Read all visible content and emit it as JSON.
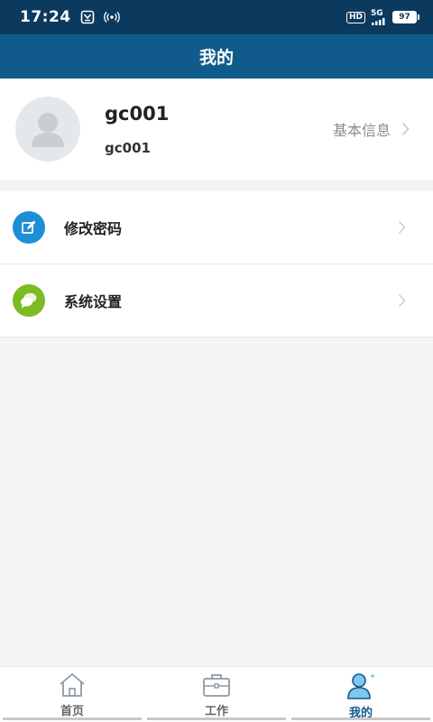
{
  "status_bar": {
    "time": "17:24",
    "hd_label": "HD",
    "network_label": "5G",
    "battery_level": "97"
  },
  "header": {
    "title": "我的"
  },
  "profile": {
    "name": "gc001",
    "account": "gc001",
    "basic_info_label": "基本信息"
  },
  "menu": {
    "items": [
      {
        "label": "修改密码",
        "icon": "edit-icon",
        "icon_color": "#1e8fd6"
      },
      {
        "label": "系统设置",
        "icon": "chat-bubble-icon",
        "icon_color": "#7dbb23"
      }
    ]
  },
  "tab_bar": {
    "tabs": [
      {
        "label": "首页",
        "icon": "home-icon",
        "active": false
      },
      {
        "label": "工作",
        "icon": "briefcase-icon",
        "active": false
      },
      {
        "label": "我的",
        "icon": "user-icon",
        "active": true
      }
    ]
  },
  "colors": {
    "status_bar_bg": "#0c3a5e",
    "title_bar_bg": "#105b8c",
    "page_bg": "#f3f4f6",
    "active_tab": "#105b8c"
  }
}
